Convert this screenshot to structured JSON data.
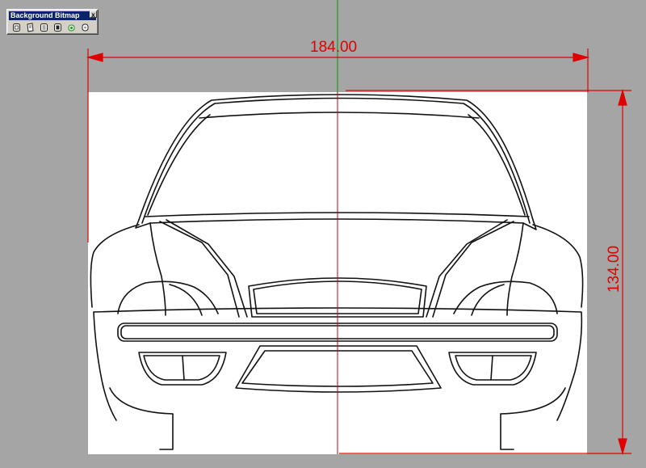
{
  "toolbar": {
    "title": "Background Bitmap",
    "close_label": "x",
    "buttons": [
      {
        "icon": "place-bitmap-icon"
      },
      {
        "icon": "move-bitmap-icon"
      },
      {
        "icon": "align-bitmap-icon"
      },
      {
        "icon": "scale-bitmap-icon"
      },
      {
        "icon": "show-bitmap-icon"
      },
      {
        "icon": "hide-bitmap-icon"
      }
    ]
  },
  "dimensions": {
    "width_value": "184.00",
    "height_value": "134.00"
  },
  "colors": {
    "viewport_bg": "#a5a5a5",
    "dimension": "#e00000",
    "axis_green": "#1c9a1c",
    "bitmap_bg": "#ffffff",
    "drawing_line": "#111111"
  }
}
